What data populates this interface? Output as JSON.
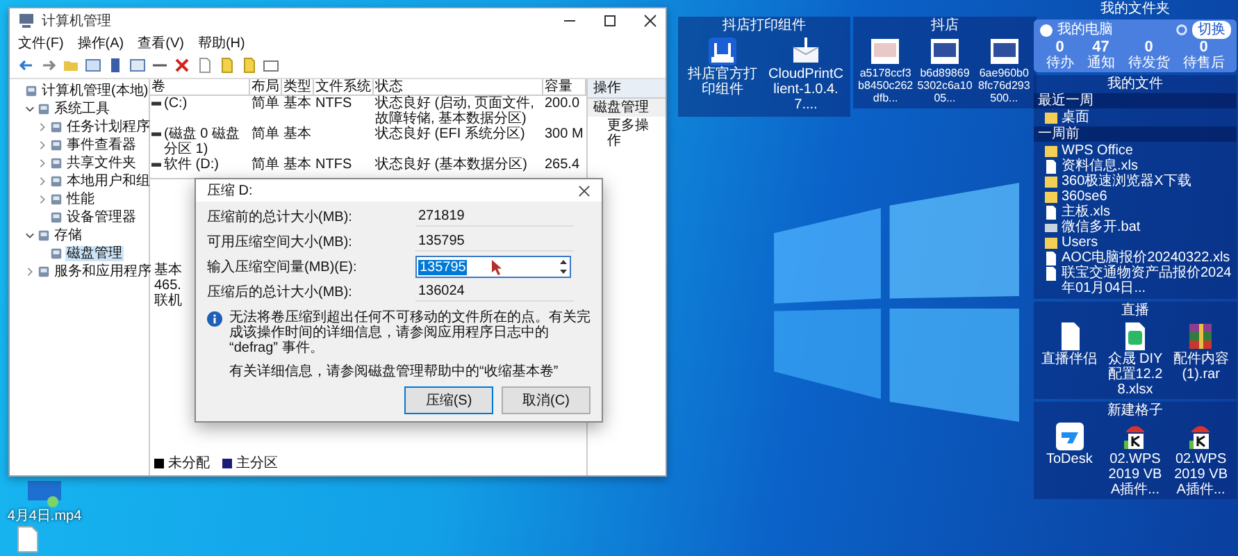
{
  "window": {
    "title": "计算机管理",
    "menu": [
      "文件(F)",
      "操作(A)",
      "查看(V)",
      "帮助(H)"
    ],
    "tree": [
      {
        "label": "计算机管理(本地)",
        "selected": false,
        "children": [
          {
            "label": "系统工具",
            "selected": false,
            "expanded": true,
            "children": [
              {
                "label": "任务计划程序",
                "selected": false,
                "expanded": false
              },
              {
                "label": "事件查看器",
                "selected": false,
                "expanded": false
              },
              {
                "label": "共享文件夹",
                "selected": false,
                "expanded": false
              },
              {
                "label": "本地用户和组",
                "selected": false,
                "expanded": false
              },
              {
                "label": "性能",
                "selected": false,
                "expanded": false
              },
              {
                "label": "设备管理器",
                "selected": false
              }
            ]
          },
          {
            "label": "存储",
            "selected": false,
            "expanded": true,
            "children": [
              {
                "label": "磁盘管理",
                "selected": true
              }
            ]
          },
          {
            "label": "服务和应用程序",
            "selected": false,
            "expanded": false
          }
        ]
      }
    ],
    "volumes": {
      "columns": [
        "卷",
        "布局",
        "类型",
        "文件系统",
        "状态",
        "容量"
      ],
      "rows": [
        {
          "volume": "(C:)",
          "layout": "简单",
          "type": "基本",
          "file_system": "NTFS",
          "status": "状态良好 (启动, 页面文件, 故障转储, 基本数据分区)",
          "capacity": "200.0"
        },
        {
          "volume": "(磁盘 0 磁盘分区 1)",
          "layout": "简单",
          "type": "基本",
          "status": "状态良好 (EFI 系统分区)",
          "capacity": "300 M"
        },
        {
          "volume": "软件 (D:)",
          "layout": "简单",
          "type": "基本",
          "file_system": "NTFS",
          "status": "状态良好 (基本数据分区)",
          "capacity": "265.4"
        }
      ]
    },
    "disk": [
      "基本",
      "465.",
      "联机"
    ],
    "legend": [
      {
        "label": "未分配",
        "color": "#000000"
      },
      {
        "label": "主分区",
        "color": "#1c1c78"
      }
    ],
    "actions": {
      "header": "操作",
      "items": [
        {
          "label": "磁盘管理",
          "kind": "group"
        },
        {
          "label": "更多操作",
          "kind": "sub"
        }
      ]
    }
  },
  "dialog": {
    "title": "压缩 D:",
    "fields": [
      {
        "label": "压缩前的总计大小(MB):",
        "value": "271819",
        "kind": "readonly"
      },
      {
        "label": "可用压缩空间大小(MB):",
        "value": "135795",
        "kind": "readonly"
      },
      {
        "label": "输入压缩空间量(MB)(E):",
        "value": "135795",
        "kind": "spin",
        "text_selected": true
      },
      {
        "label": "压缩后的总计大小(MB):",
        "value": "136024",
        "kind": "readonly"
      }
    ],
    "info": "无法将卷压缩到超出任何不可移动的文件所在的点。有关完成该操作时间的详细信息，请参阅应用程序日志中的 “defrag” 事件。",
    "help": "有关详细信息，请参阅磁盘管理帮助中的“收缩基本卷”",
    "buttons": [
      {
        "label": "压缩(S)",
        "default": true
      },
      {
        "label": "取消(C)",
        "default": false
      }
    ]
  },
  "desktop": {
    "video_file": "4月4日.mp4",
    "fences": [
      {
        "title": "抖店打印组件",
        "items": [
          {
            "label": "抖店官方打印组件",
            "kind": "app"
          },
          {
            "label": "CloudPrintClient-1.0.4.7....",
            "kind": "package"
          }
        ]
      },
      {
        "title": "抖店",
        "items": [
          {
            "label": "a5178ccf3b8450c262dfb...",
            "kind": "thumbnail"
          },
          {
            "label": "b6d898695302c6a1005...",
            "kind": "thumbnail"
          },
          {
            "label": "6ae960b08fc76d293500...",
            "kind": "thumbnail"
          }
        ]
      }
    ],
    "folder_panel": {
      "title": "我的文件夹",
      "card_title": "我的电脑",
      "switch": "切换",
      "stats": [
        {
          "value": "0",
          "label": "待办"
        },
        {
          "value": "47",
          "label": "通知"
        },
        {
          "value": "0",
          "label": "待发货"
        },
        {
          "value": "0",
          "label": "待售后"
        }
      ]
    },
    "files": {
      "title": "我的文件",
      "groups": [
        {
          "label": "最近一周",
          "items": [
            {
              "label": "桌面",
              "kind": "folder"
            }
          ]
        },
        {
          "label": "一周前",
          "items": [
            {
              "label": "WPS Office",
              "kind": "folder"
            },
            {
              "label": "资料信息.xls",
              "kind": "file"
            },
            {
              "label": "360极速浏览器X下载",
              "kind": "folder"
            },
            {
              "label": "360se6",
              "kind": "folder"
            },
            {
              "label": "主板.xls",
              "kind": "file"
            },
            {
              "label": "微信多开.bat",
              "kind": "bat"
            },
            {
              "label": "Users",
              "kind": "folder"
            },
            {
              "label": "AOC电脑报价20240322.xls",
              "kind": "file"
            },
            {
              "label": "联宝交通物资产品报价2024年01月04日...",
              "kind": "file"
            }
          ]
        }
      ]
    },
    "side_fences": [
      {
        "title": "直播",
        "items": [
          {
            "label": "直播伴侣",
            "kind": "doc"
          },
          {
            "label": "众晟 DIY 配置12.28.xlsx",
            "kind": "sheet"
          },
          {
            "label": "配件内容(1).rar",
            "kind": "archive"
          }
        ]
      },
      {
        "title": "新建格子",
        "items": [
          {
            "label": "ToDesk",
            "kind": "remote"
          },
          {
            "label": "02.WPS 2019 VBA插件...",
            "kind": "plugin"
          },
          {
            "label": "02.WPS 2019 VBA插件...",
            "kind": "plugin"
          }
        ]
      }
    ]
  }
}
